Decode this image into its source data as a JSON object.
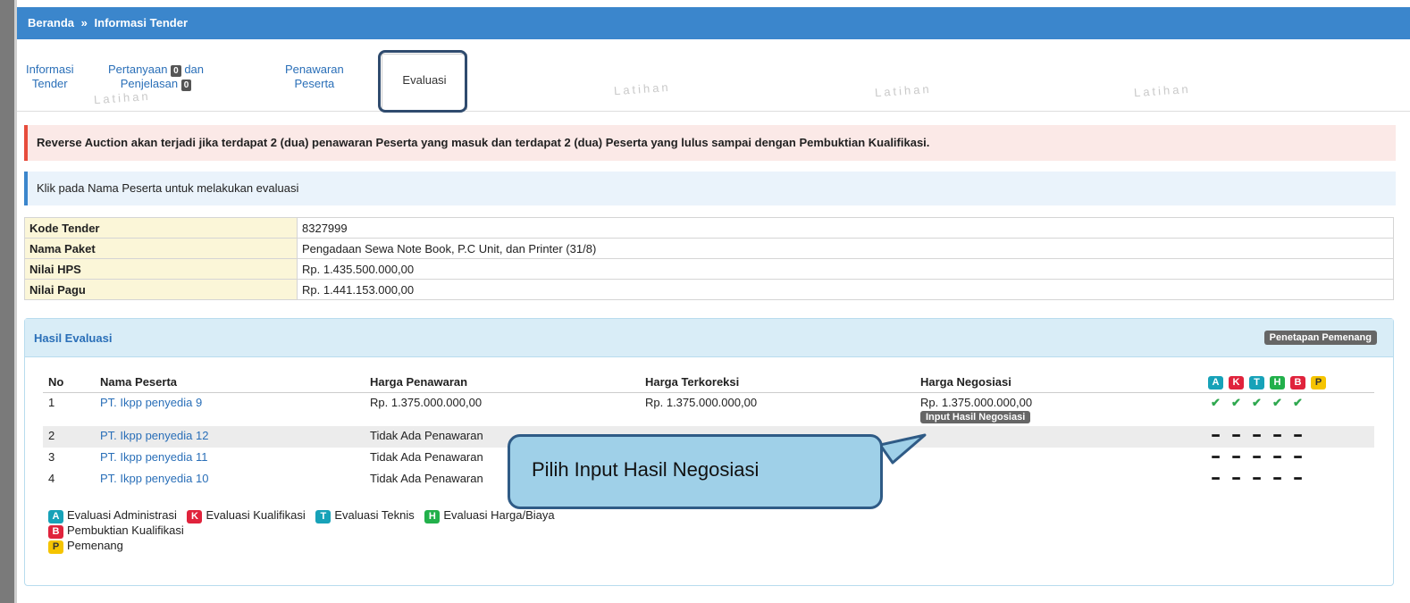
{
  "breadcrumb": {
    "home": "Beranda",
    "separator": "»",
    "current": "Informasi Tender"
  },
  "tabs": {
    "info": {
      "line1": "Informasi",
      "line2": "Tender"
    },
    "qa": {
      "line1": "Pertanyaan",
      "badge1": "0",
      "line1b": "dan",
      "line2": "Penjelasan",
      "badge2": "0"
    },
    "offer": {
      "line1": "Penawaran",
      "line2": "Peserta"
    },
    "evaluasi": "Evaluasi"
  },
  "watermark": "Latihan",
  "alerts": {
    "warning": "Reverse Auction akan terjadi jika terdapat 2 (dua) penawaran Peserta yang masuk dan terdapat 2 (dua) Peserta yang lulus sampai dengan Pembuktian Kualifikasi.",
    "info": "Klik pada Nama Peserta untuk melakukan evaluasi"
  },
  "tender_info": [
    {
      "label": "Kode Tender",
      "value": "8327999"
    },
    {
      "label": "Nama Paket",
      "value": "Pengadaan Sewa Note Book, P.C Unit, dan Printer (31/8)"
    },
    {
      "label": "Nilai HPS",
      "value": "Rp. 1.435.500.000,00"
    },
    {
      "label": "Nilai Pagu",
      "value": "Rp. 1.441.153.000,00"
    }
  ],
  "panel": {
    "title": "Hasil Evaluasi",
    "winner_button": "Penetapan Pemenang",
    "columns": {
      "no": "No",
      "name": "Nama Peserta",
      "offer": "Harga Penawaran",
      "corrected": "Harga Terkoreksi",
      "nego": "Harga Negosiasi"
    },
    "status_icons": [
      "A",
      "K",
      "T",
      "H",
      "B",
      "P"
    ],
    "rows": [
      {
        "no": "1",
        "name": "PT. Ikpp penyedia 9",
        "offer": "Rp. 1.375.000.000,00",
        "corrected": "Rp. 1.375.000.000,00",
        "nego": "Rp. 1.375.000.000,00",
        "nego_button": "Input Hasil Negosiasi"
      },
      {
        "no": "2",
        "name": "PT. Ikpp penyedia 12",
        "offer": "Tidak Ada Penawaran"
      },
      {
        "no": "3",
        "name": "PT. Ikpp penyedia 11",
        "offer": "Tidak Ada Penawaran"
      },
      {
        "no": "4",
        "name": "PT. Ikpp penyedia 10",
        "offer": "Tidak Ada Penawaran"
      }
    ],
    "legend": {
      "A": "Evaluasi Administrasi",
      "K": "Evaluasi Kualifikasi",
      "T": "Evaluasi Teknis",
      "H": "Evaluasi Harga/Biaya",
      "B": "Pembuktian Kualifikasi",
      "P": "Pemenang"
    }
  },
  "callout": "Pilih Input Hasil Negosiasi",
  "colors": {
    "header": "#3b86cc",
    "link": "#2a6fb8",
    "callout_bg": "#9fd0e8",
    "callout_border": "#2f5b86",
    "check": "#2fa84f"
  }
}
